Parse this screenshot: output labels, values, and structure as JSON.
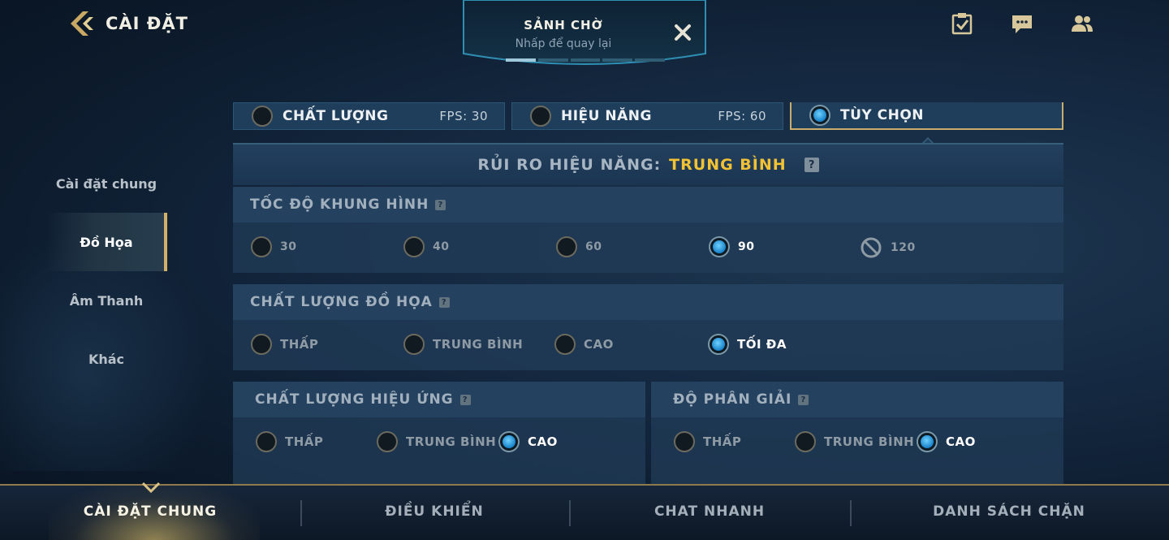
{
  "header": {
    "title": "CÀI ĐẶT",
    "lobby_title": "SẢNH CHỜ",
    "lobby_subtitle": "Nhấp để quay lại",
    "icons": [
      "checklist-icon",
      "chat-icon",
      "friends-icon"
    ]
  },
  "sidebar": {
    "items": [
      {
        "label": "Cài đặt chung"
      },
      {
        "label": "Đồ Họa"
      },
      {
        "label": "Âm Thanh"
      },
      {
        "label": "Khác"
      }
    ],
    "active_index": 1
  },
  "presets": [
    {
      "label": "CHẤT LƯỢNG",
      "fps": "FPS: 30"
    },
    {
      "label": "HIỆU NĂNG",
      "fps": "FPS: 60"
    },
    {
      "label": "TÙY CHỌN",
      "fps": ""
    }
  ],
  "risk": {
    "label": "RỦI RO HIỆU NĂNG:",
    "value": "TRUNG BÌNH",
    "help": "?"
  },
  "frame_rate": {
    "title": "TỐC ĐỘ KHUNG HÌNH",
    "options": [
      "30",
      "40",
      "60",
      "90",
      "120"
    ],
    "selected": "90",
    "disabled": "120"
  },
  "graphics_quality": {
    "title": "CHẤT LƯỢNG ĐỒ HỌA",
    "options": [
      "THẤP",
      "TRUNG BÌNH",
      "CAO",
      "TỐI ĐA"
    ],
    "selected": "TỐI ĐA"
  },
  "effects_quality": {
    "title": "CHẤT LƯỢNG HIỆU ỨNG",
    "options": [
      "THẤP",
      "TRUNG BÌNH",
      "CAO"
    ],
    "selected": "CAO"
  },
  "resolution": {
    "title": "ĐỘ PHÂN GIẢI",
    "options": [
      "THẤP",
      "TRUNG BÌNH",
      "CAO"
    ],
    "selected": "CAO"
  },
  "bottom_nav": {
    "items": [
      "CÀI ĐẶT CHUNG",
      "ĐIỀU KHIỂN",
      "CHAT NHANH",
      "DANH SÁCH CHẶN"
    ],
    "active_index": 0
  },
  "colors": {
    "accent_gold": "#d3b06a",
    "risk_yellow": "#f2c234",
    "radio_blue": "#1782c8"
  }
}
